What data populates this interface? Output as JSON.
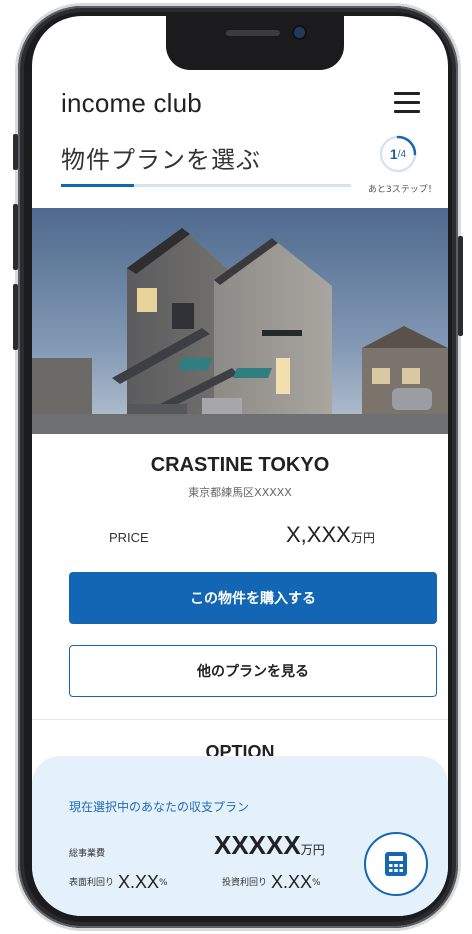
{
  "header": {
    "brand": "income club",
    "menu_icon": "hamburger-menu-icon"
  },
  "step": {
    "title": "物件プランを選ぶ",
    "current": "1",
    "total": "/4",
    "remaining": "あと3ステップ！",
    "progress": 0.25,
    "accent": "#1565b7"
  },
  "property": {
    "name": "CRASTINE TOKYO",
    "address": "東京都練馬区XXXXX",
    "price_label": "PRICE",
    "price_value": "X,XXX",
    "price_unit": "万円"
  },
  "actions": {
    "buy_label": "この物件を購入する",
    "other_label": "他のプランを見る"
  },
  "option": {
    "title": "OPTION"
  },
  "summary": {
    "title": "現在選択中のあなたの収支プラン",
    "total_label": "総事業費",
    "total_value": "XXXXX",
    "total_unit": "万円",
    "surface_yield_label": "表面利回り",
    "surface_yield_value": "X.XX",
    "investment_yield_label": "投資利回り",
    "investment_yield_value": "X.XX",
    "percent_unit": "%",
    "calc_icon": "calculator-icon"
  },
  "colors": {
    "primary": "#1266b3",
    "panel_bg": "#e4f0fa"
  }
}
